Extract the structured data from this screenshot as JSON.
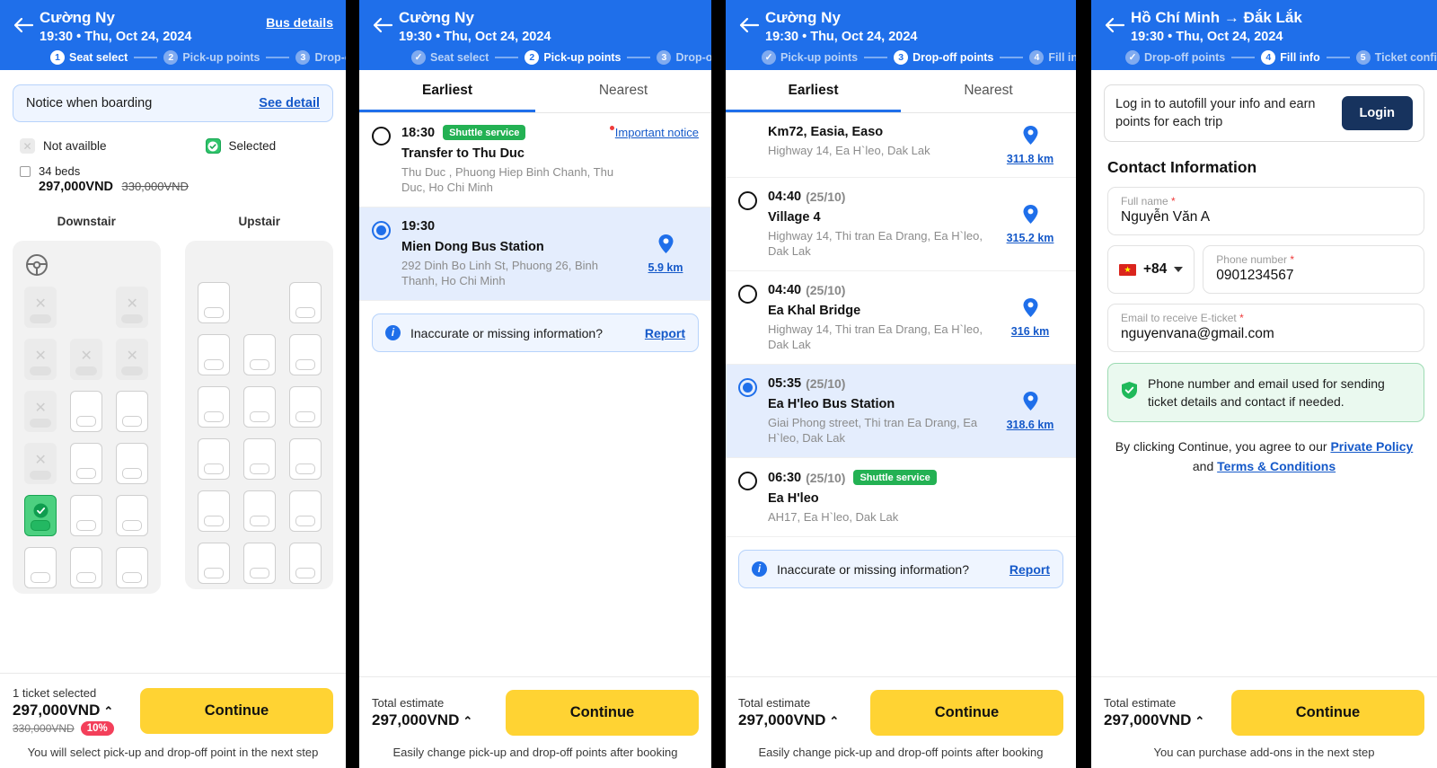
{
  "panel1": {
    "header": {
      "title": "Cường Ny",
      "subtitle": "19:30 • Thu, Oct 24, 2024",
      "action_link": "Bus details",
      "steps": [
        {
          "num": "1",
          "label": "Seat select",
          "state": "current"
        },
        {
          "num": "2",
          "label": "Pick-up points",
          "state": "todo"
        },
        {
          "num": "3",
          "label": "Drop-off points",
          "state": "todo"
        }
      ]
    },
    "notice": {
      "text": "Notice when boarding",
      "link": "See detail"
    },
    "legend": {
      "not_available": "Not availble",
      "selected": "Selected"
    },
    "beds": {
      "label": "34 beds",
      "price": "297,000VND",
      "old_price": "330,000VND"
    },
    "decks": [
      {
        "title": "Downstair",
        "has_wheel": true,
        "seats": [
          "na",
          "empty",
          "na",
          "na",
          "na",
          "na",
          "na",
          "free",
          "free",
          "na",
          "free",
          "free",
          "selected",
          "free",
          "free",
          "free",
          "free",
          "free"
        ]
      },
      {
        "title": "Upstair",
        "has_wheel": false,
        "seats": [
          "free",
          "empty",
          "free",
          "free",
          "free",
          "free",
          "free",
          "free",
          "free",
          "free",
          "free",
          "free",
          "free",
          "free",
          "free",
          "free",
          "free",
          "free"
        ]
      }
    ],
    "footer": {
      "caption": "1 ticket selected",
      "price": "297,000VND",
      "chevron": "⌃",
      "old_price": "330,000VND",
      "discount": "10%",
      "button": "Continue",
      "note": "You will select pick-up and drop-off point in the next step"
    }
  },
  "panel2": {
    "header": {
      "title": "Cường Ny",
      "subtitle": "19:30 • Thu, Oct 24, 2024",
      "action_link": "",
      "steps": [
        {
          "num": "✓",
          "label": "Seat select",
          "state": "done"
        },
        {
          "num": "2",
          "label": "Pick-up points",
          "state": "current"
        },
        {
          "num": "3",
          "label": "Drop-off",
          "state": "todo"
        }
      ]
    },
    "tabs": [
      {
        "label": "Earliest",
        "active": true
      },
      {
        "label": "Nearest",
        "active": false
      }
    ],
    "stops": [
      {
        "selected": false,
        "time": "18:30",
        "date": "",
        "badge": "Shuttle service",
        "name": "Transfer to Thu Duc",
        "address": "Thu Duc , Phuong Hiep Binh Chanh, Thu Duc, Ho Chi Minh",
        "km": "",
        "notice": "Important notice"
      },
      {
        "selected": true,
        "time": "19:30",
        "date": "",
        "badge": "",
        "name": "Mien Dong Bus Station",
        "address": "292 Dinh Bo Linh St, Phuong 26, Binh Thanh, Ho Chi Minh",
        "km": "5.9 km",
        "notice": ""
      }
    ],
    "report": {
      "text": "Inaccurate or missing information?",
      "link": "Report"
    },
    "footer": {
      "caption": "Total estimate",
      "price": "297,000VND",
      "chevron": "⌃",
      "old_price": "",
      "discount": "",
      "button": "Continue",
      "note": "Easily change pick-up and drop-off points after booking"
    }
  },
  "panel3": {
    "header": {
      "title": "Cường Ny",
      "subtitle": "19:30 • Thu, Oct 24, 2024",
      "action_link": "",
      "steps": [
        {
          "num": "✓",
          "label": "Pick-up points",
          "state": "done"
        },
        {
          "num": "3",
          "label": "Drop-off points",
          "state": "current"
        },
        {
          "num": "4",
          "label": "Fill info",
          "state": "todo"
        }
      ]
    },
    "tabs": [
      {
        "label": "Earliest",
        "active": true
      },
      {
        "label": "Nearest",
        "active": false
      }
    ],
    "stops": [
      {
        "selected": false,
        "clipped": true,
        "time": "",
        "date": "",
        "badge": "",
        "name": "Km72, Easia, Easo",
        "address": "Highway 14, Ea H`leo, Dak Lak",
        "km": "311.8 km",
        "notice": ""
      },
      {
        "selected": false,
        "time": "04:40",
        "date": "(25/10)",
        "badge": "",
        "name": "Village 4",
        "address": "Highway 14, Thi tran Ea Drang, Ea H`leo, Dak Lak",
        "km": "315.2 km",
        "notice": ""
      },
      {
        "selected": false,
        "time": "04:40",
        "date": "(25/10)",
        "badge": "",
        "name": "Ea Khal Bridge",
        "address": "Highway 14, Thi tran Ea Drang, Ea H`leo, Dak Lak",
        "km": "316 km",
        "notice": ""
      },
      {
        "selected": true,
        "time": "05:35",
        "date": "(25/10)",
        "badge": "",
        "name": "Ea H'leo Bus Station",
        "address": "Giai Phong street, Thi tran Ea Drang, Ea H`leo, Dak Lak",
        "km": "318.6 km",
        "notice": ""
      },
      {
        "selected": false,
        "time": "06:30",
        "date": "(25/10)",
        "badge": "Shuttle service",
        "name": "Ea H'leo",
        "address": "AH17, Ea H`leo, Dak Lak",
        "km": "",
        "notice": ""
      }
    ],
    "report": {
      "text": "Inaccurate or missing information?",
      "link": "Report"
    },
    "footer": {
      "caption": "Total estimate",
      "price": "297,000VND",
      "chevron": "⌃",
      "old_price": "",
      "discount": "",
      "button": "Continue",
      "note": "Easily change pick-up and drop-off points after booking"
    }
  },
  "panel4": {
    "header": {
      "title": "Hồ Chí Minh → Đắk Lắk",
      "subtitle": "19:30 • Thu, Oct 24, 2024",
      "action_link": "",
      "steps": [
        {
          "num": "✓",
          "label": "Drop-off points",
          "state": "done"
        },
        {
          "num": "4",
          "label": "Fill info",
          "state": "current"
        },
        {
          "num": "5",
          "label": "Ticket confirm",
          "state": "todo"
        }
      ]
    },
    "login": {
      "text": "Log in to autofill your info and earn points for each trip",
      "button": "Login"
    },
    "section_title": "Contact Information",
    "fields": {
      "full_name": {
        "label": "Full name",
        "required": "*",
        "value": "Nguyễn Văn A"
      },
      "country_code": {
        "value": "+84",
        "flag": "★"
      },
      "phone": {
        "label": "Phone number",
        "required": "*",
        "value": "0901234567"
      },
      "email": {
        "label": "Email to receive E-ticket",
        "required": "*",
        "value": "nguyenvana@gmail.com"
      }
    },
    "info_note": "Phone number and email used for sending ticket details and contact if needed.",
    "agreement": {
      "prefix": "By clicking Continue, you agree to our ",
      "link1": "Private Policy",
      "middle": " and ",
      "link2": "Terms & Conditions"
    },
    "footer": {
      "caption": "Total estimate",
      "price": "297,000VND",
      "chevron": "⌃",
      "old_price": "",
      "discount": "",
      "button": "Continue",
      "note": "You can purchase add-ons in the next step"
    }
  }
}
